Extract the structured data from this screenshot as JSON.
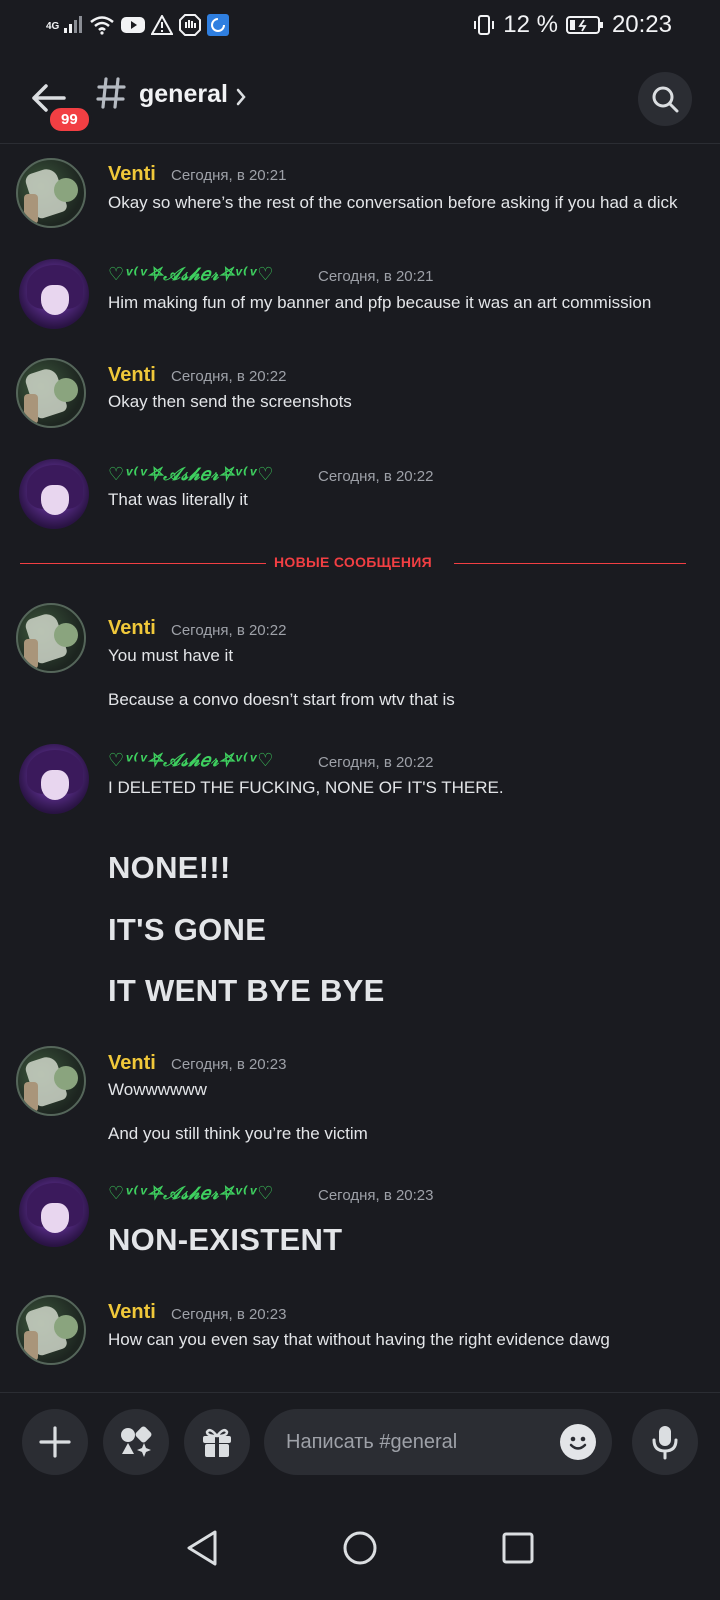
{
  "status_bar": {
    "network": "4G",
    "battery_percent": "12 %",
    "time": "20:23",
    "icons": [
      "signal-icon",
      "wifi-icon",
      "youtube-icon",
      "warning-icon",
      "shield-icon",
      "sync-icon",
      "vibrate-icon",
      "battery-icon"
    ]
  },
  "header": {
    "unread_count": "99",
    "channel_name": "general"
  },
  "colors": {
    "background": "#1a1b20",
    "venti": "#f0c83a",
    "asher": "#3ed05f",
    "new_divider": "#f23f43",
    "badge": "#f23f43"
  },
  "messages": [
    {
      "author": "Venti",
      "time": "Сегодня, в 20:21",
      "lines": [
        "Okay so where’s the rest of the conversation before asking if you had a dick"
      ]
    },
    {
      "author": "♡ᵛ⁽ᵛ⛧𝒜𝓈𝒽𝑒𝓇⛧ᵛ⁽ᵛ♡",
      "time": "Сегодня, в 20:21",
      "lines": [
        "Him making fun of my banner and pfp because it was an art commission"
      ]
    },
    {
      "author": "Venti",
      "time": "Сегодня, в 20:22",
      "lines": [
        "Okay then send the screenshots"
      ]
    },
    {
      "author": "♡ᵛ⁽ᵛ⛧𝒜𝓈𝒽𝑒𝓇⛧ᵛ⁽ᵛ♡",
      "time": "Сегодня, в 20:22",
      "lines": [
        "That was literally it"
      ]
    },
    {
      "author": "Venti",
      "time": "Сегодня, в 20:22",
      "lines": [
        "You must have it",
        "Because a convo doesn’t start from wtv that is"
      ]
    },
    {
      "author": "♡ᵛ⁽ᵛ⛧𝒜𝓈𝒽𝑒𝓇⛧ᵛ⁽ᵛ♡",
      "time": "Сегодня, в 20:22",
      "lines": [
        "I DELETED THE FUCKING, NONE OF IT'S THERE."
      ],
      "headings": [
        "NONE!!!",
        "IT'S GONE",
        "IT WENT BYE BYE"
      ]
    },
    {
      "author": "Venti",
      "time": "Сегодня, в 20:23",
      "lines": [
        "Wowwwwww",
        "And you still think you’re the victim"
      ]
    },
    {
      "author": "♡ᵛ⁽ᵛ⛧𝒜𝓈𝒽𝑒𝓇⛧ᵛ⁽ᵛ♡",
      "time": "Сегодня, в 20:23",
      "headings": [
        "NON-EXISTENT"
      ]
    },
    {
      "author": "Venti",
      "time": "Сегодня, в 20:23",
      "lines": [
        "How can you even say that without having the right evidence dawg"
      ]
    }
  ],
  "new_messages_label": "НОВЫЕ СООБЩЕНИЯ",
  "composer": {
    "placeholder": "Написать #general",
    "buttons": [
      "plus-icon",
      "apps-icon",
      "gift-icon",
      "mic-icon"
    ]
  },
  "nav": [
    "back-nav-icon",
    "home-nav-icon",
    "recents-nav-icon"
  ]
}
